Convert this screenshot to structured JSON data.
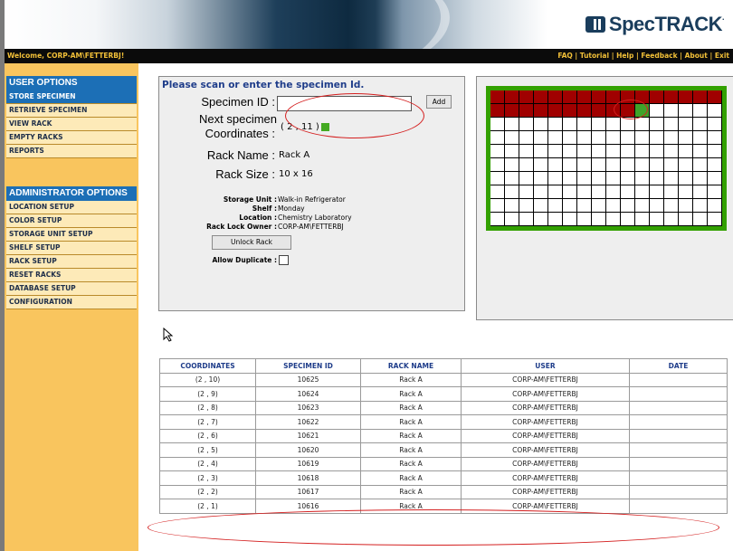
{
  "header": {
    "logo_text": "SpecTRACK",
    "welcome": "Welcome, CORP-AM\\FETTERBJ!",
    "links": [
      "FAQ",
      "Tutorial",
      "Help",
      "Feedback",
      "About",
      "Exit"
    ],
    "separator": "|"
  },
  "sidebar": {
    "user_options_title": "USER OPTIONS",
    "user_items": [
      "Store Specimen",
      "Retrieve Specimen",
      "View Rack",
      "Empty Racks",
      "Reports"
    ],
    "admin_title": "ADMINISTRATOR OPTIONS",
    "admin_items": [
      "Location Setup",
      "Color Setup",
      "Storage Unit Setup",
      "Shelf Setup",
      "Rack Setup",
      "Reset Racks",
      "Database Setup",
      "Configuration"
    ]
  },
  "form": {
    "prompt": "Please scan or enter the specimen Id.",
    "specimen_id_label": "Specimen ID :",
    "specimen_id_value": "",
    "add_button": "Add",
    "next_specimen_label": "Next specimen",
    "coordinates_label": "Coordinates :",
    "coordinates_value": "( 2 , 11 )",
    "rack_name_label": "Rack Name :",
    "rack_name_value": "Rack A",
    "rack_size_label": "Rack Size :",
    "rack_size_value": "10 x 16",
    "storage_unit_label": "Storage Unit :",
    "storage_unit_value": "Walk-in Refrigerator",
    "shelf_label": "Shelf :",
    "shelf_value": "Monday",
    "location_label": "Location :",
    "location_value": "Chemistry Laboratory",
    "lock_owner_label": "Rack Lock Owner :",
    "lock_owner_value": "CORP-AM\\FETTERBJ",
    "unlock_button": "Unlock Rack",
    "allow_duplicate_label": "Allow Duplicate :",
    "allow_duplicate_checked": false
  },
  "rack": {
    "rows": 10,
    "cols": 16,
    "filled_rows": 2,
    "filled_cols_row2": 10,
    "next_position": [
      2,
      11
    ],
    "colors": {
      "filled": "#a00000",
      "next": "#3fa32a",
      "empty": "#ffffff",
      "border": "#33a000"
    }
  },
  "table": {
    "headers": [
      "Coordinates",
      "Specimen ID",
      "Rack Name",
      "User",
      "Date"
    ],
    "rows": [
      [
        "(2 , 10)",
        "10625",
        "Rack A",
        "CORP-AM\\FETTERBJ",
        ""
      ],
      [
        "(2 , 9)",
        "10624",
        "Rack A",
        "CORP-AM\\FETTERBJ",
        ""
      ],
      [
        "(2 , 8)",
        "10623",
        "Rack A",
        "CORP-AM\\FETTERBJ",
        ""
      ],
      [
        "(2 , 7)",
        "10622",
        "Rack A",
        "CORP-AM\\FETTERBJ",
        ""
      ],
      [
        "(2 , 6)",
        "10621",
        "Rack A",
        "CORP-AM\\FETTERBJ",
        ""
      ],
      [
        "(2 , 5)",
        "10620",
        "Rack A",
        "CORP-AM\\FETTERBJ",
        ""
      ],
      [
        "(2 , 4)",
        "10619",
        "Rack A",
        "CORP-AM\\FETTERBJ",
        ""
      ],
      [
        "(2 , 3)",
        "10618",
        "Rack A",
        "CORP-AM\\FETTERBJ",
        ""
      ],
      [
        "(2 , 2)",
        "10617",
        "Rack A",
        "CORP-AM\\FETTERBJ",
        ""
      ],
      [
        "(2 , 1)",
        "10616",
        "Rack A",
        "CORP-AM\\FETTERBJ",
        ""
      ]
    ]
  }
}
